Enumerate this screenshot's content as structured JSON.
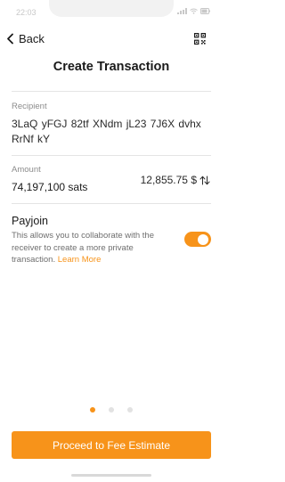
{
  "status_bar": {
    "time": "22:03"
  },
  "header": {
    "back_label": "Back",
    "title": "Create Transaction",
    "qr_icon": "qr-code-icon"
  },
  "recipient": {
    "label": "Recipient",
    "address": "3LaQ yFGJ 82tf XNdm jL23 7J6X dvhx RrNf kY"
  },
  "amount": {
    "label": "Amount",
    "sats": "74,197,100 sats",
    "fiat": "12,855.75 $",
    "swap_icon": "swap-vertical-icon"
  },
  "payjoin": {
    "title": "Payjoin",
    "description": "This allows you to collaborate with the receiver to create a more private transaction.",
    "learn_more": "Learn More",
    "enabled": true
  },
  "pagination": {
    "total": 3,
    "active_index": 0
  },
  "primary_action": {
    "label": "Proceed to Fee Estimate"
  },
  "colors": {
    "accent": "#f7931a",
    "text": "#1a1a1a",
    "muted": "#8c8c8c",
    "divider": "#e4e4e4"
  }
}
